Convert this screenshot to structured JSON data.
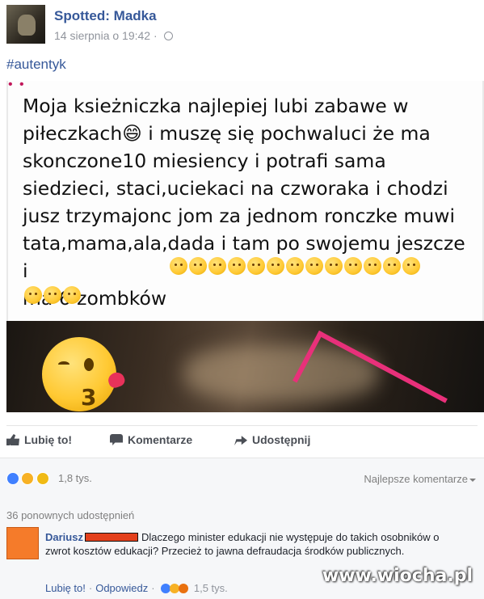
{
  "post": {
    "page_name": "Spotted: Madka",
    "timestamp": "14 sierpnia o 19:42",
    "meta_separator": "·",
    "hashtag": "#autentyk"
  },
  "image_text": {
    "lines": "Moja ksieżniczka najlepiej lubi zabawe w\npiłeczkach😄 i muszę się pochwaluci że ma\nskonczone10 miesiency i potrafi sama\nsiedzieci, staci,uciekaci na czworaka i chodzi\njusz trzymajonc  jom za  jednom ronczke muwi\ntata,mama,ala,dada i tam po swojemu jeszcze i\nma 6 zombków",
    "emoji_count": 16
  },
  "actions": {
    "like": "Lubię to!",
    "comment": "Komentarze",
    "share": "Udostępnij"
  },
  "reactions": {
    "count": "1,8 tys.",
    "sort": "Najlepsze komentarze",
    "icons": [
      "like-reaction-icon",
      "haha-reaction-icon",
      "sad-reaction-icon"
    ]
  },
  "shares": {
    "label": "36 ponownych udostępnień"
  },
  "comment": {
    "author": "Dariusz",
    "text": "Dlaczego minister edukacji nie występuje do takich osobników o zwrot kosztów edukacji? Przecież to jawna defraudacja środków publicznych.",
    "like": "Lubię to!",
    "reply": "Odpowiedz",
    "count": "1,5 tys."
  },
  "watermark": "www.wiocha.pl",
  "colors": {
    "link_blue": "#365899",
    "like_blue": "#4080ff",
    "redaction": "#e4401c",
    "avatar_orange": "#f57b2a"
  }
}
